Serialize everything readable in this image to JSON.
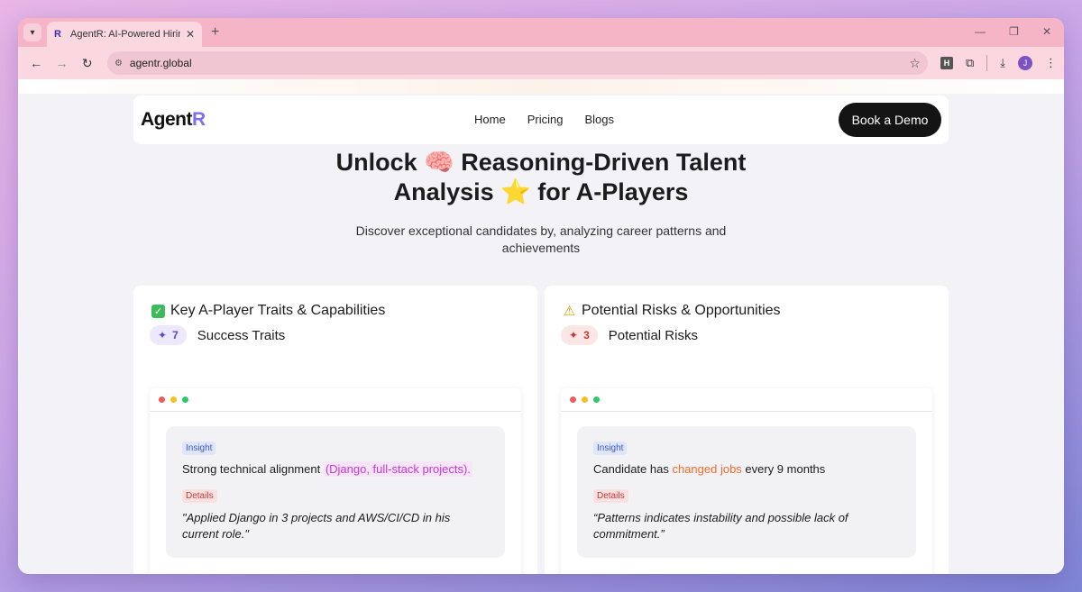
{
  "browser": {
    "tab_title": "AgentR: AI-Powered Hiring Assis",
    "tab_favicon": "R",
    "url": "agentr.global",
    "profile_initial": "J",
    "ext_h": "H"
  },
  "nav": {
    "logo_main": "Agent",
    "logo_accent": "R",
    "links": [
      "Home",
      "Pricing",
      "Blogs"
    ],
    "cta": "Book a Demo"
  },
  "hero": {
    "title_line1": "Unlock 🧠 Reasoning-Driven Talent",
    "title_line2": "Analysis ⭐ for A-Players",
    "sub_line1": "Discover exceptional candidates by, analyzing career patterns and",
    "sub_line2": "achievements"
  },
  "cards": [
    {
      "title": "Key A-Player Traits & Capabilities",
      "icon": "✓",
      "count": "7",
      "count_label": "Success Traits",
      "insight_tag": "Insight",
      "insight_before": "Strong technical alignment ",
      "insight_highlight": "(Django, full-stack projects).",
      "insight_after": "",
      "details_tag": "Details",
      "quote": "\"Applied Django in 3 projects and AWS/CI/CD in his current role.\""
    },
    {
      "title": "Potential Risks & Opportunities",
      "icon": "⚠",
      "count": "3",
      "count_label": "Potential Risks",
      "insight_tag": "Insight",
      "insight_before": "Candidate has ",
      "insight_highlight": "changed jobs",
      "insight_after": " every 9 months",
      "details_tag": "Details",
      "quote": "“Patterns indicates instability and possible lack of commitment.”"
    }
  ]
}
